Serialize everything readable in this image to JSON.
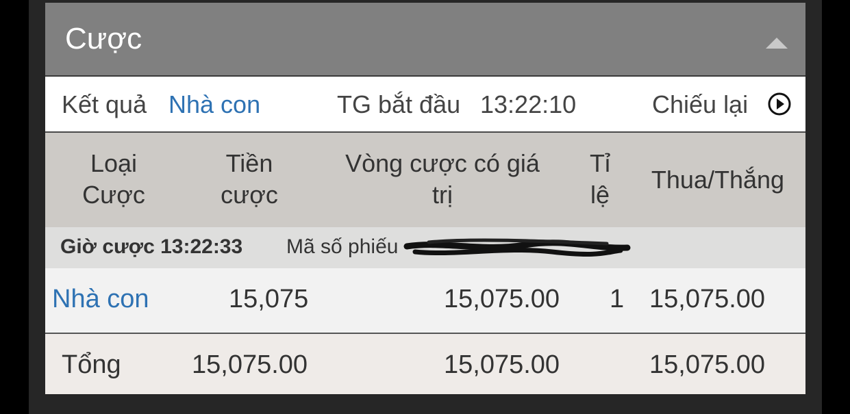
{
  "header": {
    "title": "Cược",
    "collapse_icon": "triangle-up-icon"
  },
  "info": {
    "result_label": "Kết quả",
    "result_value": "Nhà con",
    "start_time_label": "TG bắt đầu",
    "start_time_value": "13:22:10",
    "replay_label": "Chiếu lại",
    "replay_icon": "play-circle-icon"
  },
  "columns": [
    {
      "line1": "Loại",
      "line2": "Cược"
    },
    {
      "line1": "Tiền",
      "line2": "cược"
    },
    {
      "line1": "Vòng cược có giá",
      "line2": "trị"
    },
    {
      "line1": "Tỉ",
      "line2": "lệ"
    },
    {
      "line1": "Thua/Thắng",
      "line2": ""
    }
  ],
  "bet": {
    "time_label": "Giờ cược 13:22:33",
    "ticket_label": "Mã số phiếu"
  },
  "row": {
    "type": "Nhà con",
    "amount": "15,075",
    "valid_turnover": "15,075.00",
    "odds": "1",
    "win_loss": "15,075.00"
  },
  "total": {
    "label": "Tổng",
    "amount": "15,075.00",
    "valid_turnover": "15,075.00",
    "win_loss": "15,075.00"
  },
  "colors": {
    "link": "#2e72b3",
    "header_bg": "#808080",
    "table_head_bg": "#cdcac6"
  }
}
